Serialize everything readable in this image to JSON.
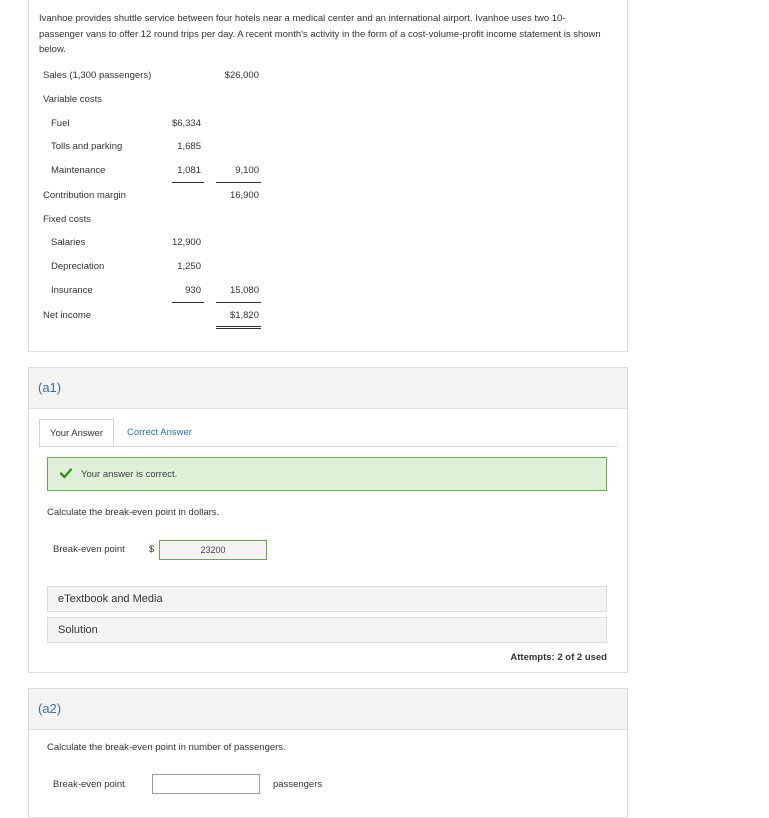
{
  "problem": {
    "intro": "Ivanhoe provides shuttle service between four hotels near a medical center and an international airport. Ivanhoe uses two 10-passenger vans to offer 12 round trips per day. A recent month's activity in the form of a cost-volume-profit income statement is shown below.",
    "statement": {
      "sales_label": "Sales (1,300 passengers)",
      "sales_value": "$26,000",
      "variable_costs_label": "Variable costs",
      "fuel_label": "Fuel",
      "fuel_value": "$6,334",
      "tolls_label": "Tolls and parking",
      "tolls_value": "1,685",
      "maintenance_label": "Maintenance",
      "maintenance_value": "1,081",
      "variable_total": "9,100",
      "contribution_label": "Contribution margin",
      "contribution_value": "16,900",
      "fixed_costs_label": "Fixed costs",
      "salaries_label": "Salaries",
      "salaries_value": "12,900",
      "depreciation_label": "Depreciation",
      "depreciation_value": "1,250",
      "insurance_label": "Insurance",
      "insurance_value": "930",
      "fixed_total": "15,080",
      "net_income_label": "Net income",
      "net_income_value": "$1,820"
    }
  },
  "a1": {
    "title": "(a1)",
    "tab_your_answer": "Your Answer",
    "tab_correct_answer": "Correct Answer",
    "success_message": "Your answer is correct.",
    "question": "Calculate the break-even point in dollars.",
    "field_label": "Break-even point",
    "currency": "$",
    "answer_value": "23200",
    "etextbook_label": "eTextbook and Media",
    "solution_label": "Solution",
    "attempts": "Attempts: 2 of 2 used"
  },
  "a2": {
    "title": "(a2)",
    "question": "Calculate the break-even point in number of passengers.",
    "field_label": "Break-even point",
    "input_value": "",
    "unit": "passengers"
  },
  "colors": {
    "accent": "#3a6ea5",
    "success_bg": "#dff0d8",
    "success_border": "#6aa84f",
    "check": "#3c8b2e"
  }
}
